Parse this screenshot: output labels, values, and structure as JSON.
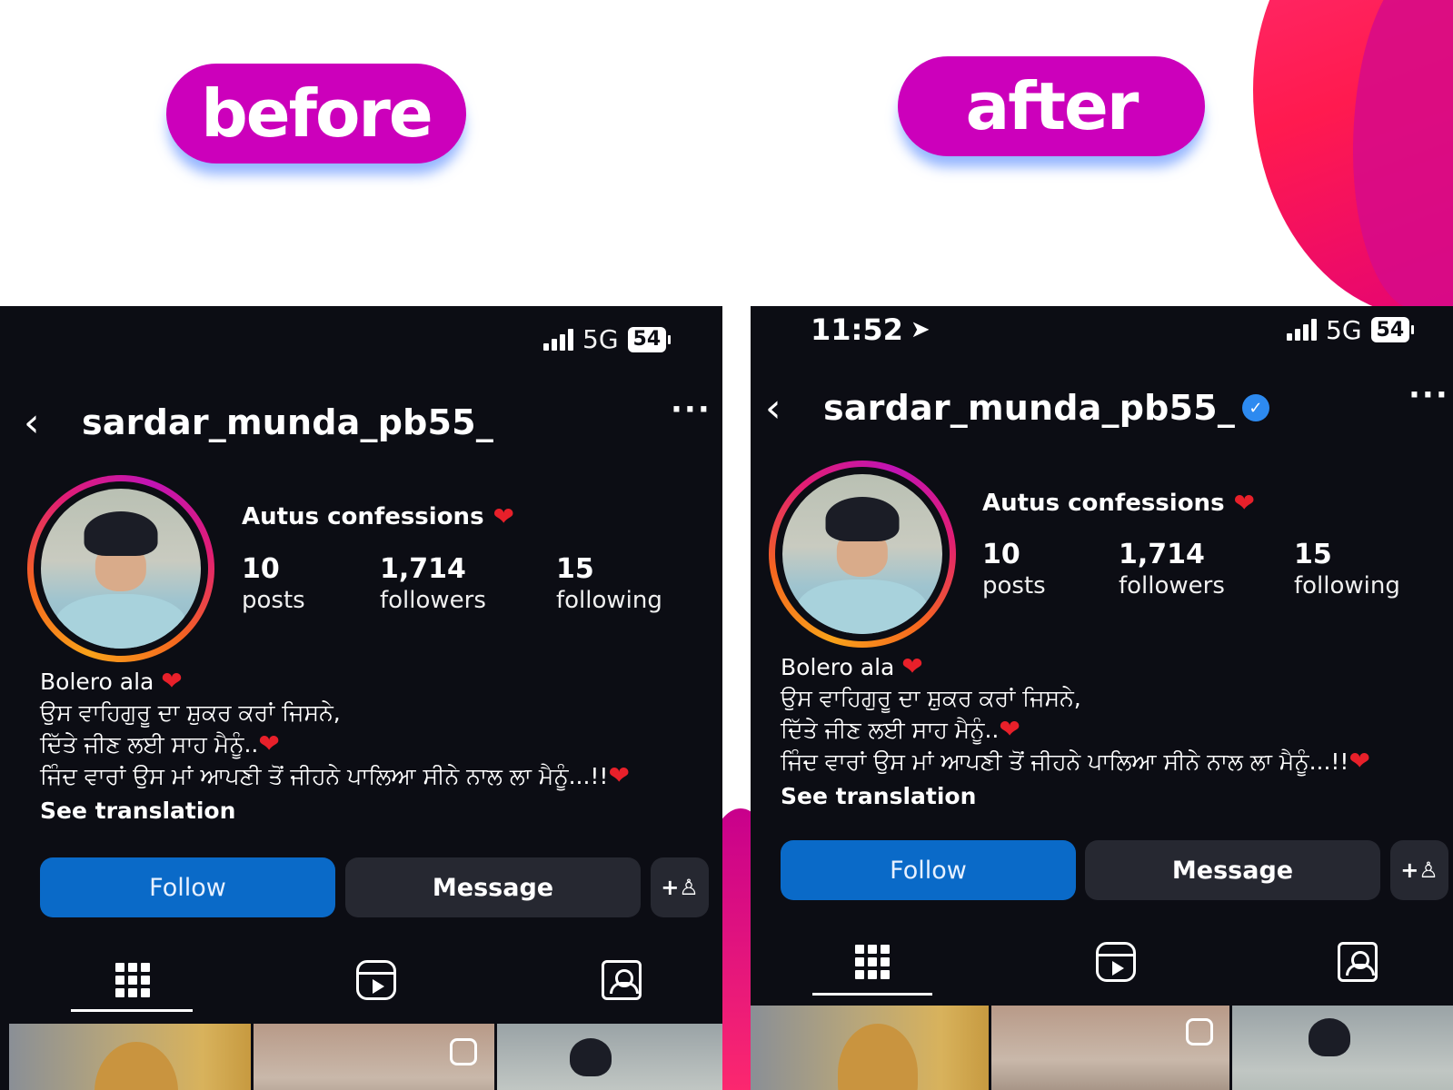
{
  "labels": {
    "before": "before",
    "after": "after"
  },
  "colors": {
    "pill": "#cc00bb",
    "follow_button": "#0a6ac8",
    "panel_bg": "#0c0d14",
    "accent_blob": "#ff1a4f",
    "heart": "#e8202a",
    "verified": "#2d8af0"
  },
  "before": {
    "status": {
      "network": "5G",
      "battery": "54"
    },
    "username": "sardar_munda_pb55_",
    "more": "···",
    "display_name": "Autus confessions",
    "stats": [
      {
        "value": "10",
        "label": "posts"
      },
      {
        "value": "1,714",
        "label": "followers"
      },
      {
        "value": "15",
        "label": "following"
      }
    ],
    "bio": {
      "line1": "Bolero ala",
      "line2": "ਉਸ ਵਾਹਿਗੁਰੂ ਦਾ ਸ਼ੁਕਰ ਕਰਾਂ ਜਿਸਨੇ,",
      "line3": "ਦਿੱਤੇ ਜੀਣ ਲਈ ਸਾਹ ਮੈਨੂੰ..",
      "line4": "ਜਿੰਦ ਵਾਰਾਂ ਉਸ ਮਾਂ ਆਪਣੀ ਤੋਂ ਜੀਹਨੇ ਪਾਲਿਆ ਸੀਨੇ ਨਾਲ ਲਾ ਮੈਨੂੰ...!!",
      "see_translation": "See translation"
    },
    "buttons": {
      "follow": "Follow",
      "message": "Message",
      "add_user": "+♙"
    }
  },
  "after": {
    "status": {
      "time": "11:52",
      "network": "5G",
      "battery": "54"
    },
    "username": "sardar_munda_pb55_",
    "more": "···",
    "display_name": "Autus confessions",
    "stats": [
      {
        "value": "10",
        "label": "posts"
      },
      {
        "value": "1,714",
        "label": "followers"
      },
      {
        "value": "15",
        "label": "following"
      }
    ],
    "bio": {
      "line1": "Bolero ala",
      "line2": "ਉਸ ਵਾਹਿਗੁਰੂ ਦਾ ਸ਼ੁਕਰ ਕਰਾਂ ਜਿਸਨੇ,",
      "line3": "ਦਿੱਤੇ ਜੀਣ ਲਈ ਸਾਹ ਮੈਨੂੰ..",
      "line4": "ਜਿੰਦ ਵਾਰਾਂ ਉਸ ਮਾਂ ਆਪਣੀ ਤੋਂ ਜੀਹਨੇ ਪਾਲਿਆ ਸੀਨੇ ਨਾਲ ਲਾ ਮੈਨੂੰ...!!",
      "see_translation": "See translation"
    },
    "buttons": {
      "follow": "Follow",
      "message": "Message",
      "add_user": "+♙"
    }
  },
  "icons": {
    "back": "chevron-left-icon",
    "more": "more-horizontal-icon",
    "heart": "heart-icon",
    "verified": "verified-badge-icon",
    "location": "location-arrow-icon",
    "grid": "grid-icon",
    "reels": "reels-icon",
    "tagged": "tagged-icon"
  }
}
